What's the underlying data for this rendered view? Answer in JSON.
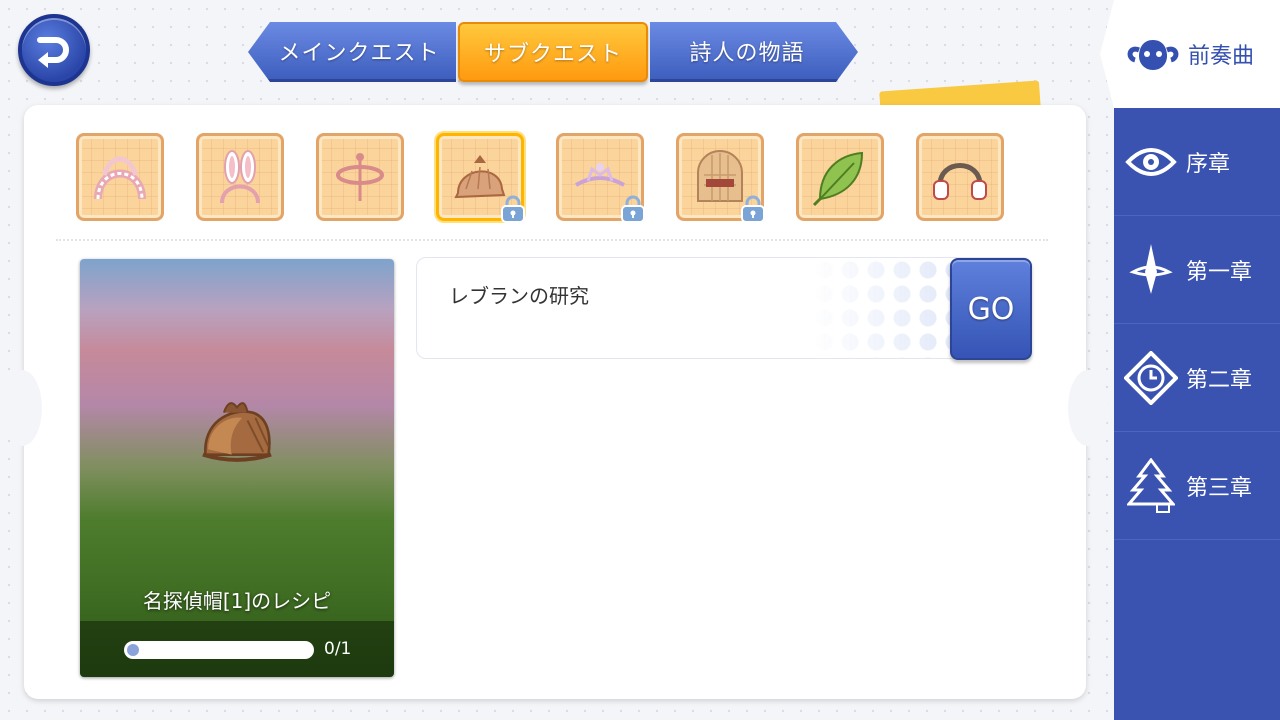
{
  "tabs": [
    {
      "label": "メインクエスト",
      "active": false
    },
    {
      "label": "サブクエスト",
      "active": true
    },
    {
      "label": "詩人の物語",
      "active": false
    }
  ],
  "recipes": [
    {
      "icon": "maid-headband-icon",
      "locked": false,
      "selected": false
    },
    {
      "icon": "bunny-ears-icon",
      "locked": false,
      "selected": false
    },
    {
      "icon": "halo-icon",
      "locked": false,
      "selected": false
    },
    {
      "icon": "detective-hat-icon",
      "locked": true,
      "selected": true
    },
    {
      "icon": "tiara-icon",
      "locked": true,
      "selected": false
    },
    {
      "icon": "helmet-icon",
      "locked": true,
      "selected": false
    },
    {
      "icon": "leaf-icon",
      "locked": false,
      "selected": false
    },
    {
      "icon": "headphones-icon",
      "locked": false,
      "selected": false
    }
  ],
  "preview": {
    "name": "名探偵帽[1]のレシピ",
    "progress_text": "0/1",
    "progress_fraction": 0
  },
  "quest": {
    "title": "レブランの研究",
    "go_label": "GO"
  },
  "sidebar": {
    "items": [
      {
        "label": "前奏曲",
        "icon": "ram-skull-icon",
        "active": true
      },
      {
        "label": "序章",
        "icon": "eye-emblem-icon",
        "active": false
      },
      {
        "label": "第一章",
        "icon": "sword-emblem-icon",
        "active": false
      },
      {
        "label": "第二章",
        "icon": "compass-emblem-icon",
        "active": false
      },
      {
        "label": "第三章",
        "icon": "tree-emblem-icon",
        "active": false
      }
    ]
  },
  "colors": {
    "accent_blue": "#3a52b0",
    "active_tab": "#ffb020",
    "item_bg": "#fbd49b"
  }
}
